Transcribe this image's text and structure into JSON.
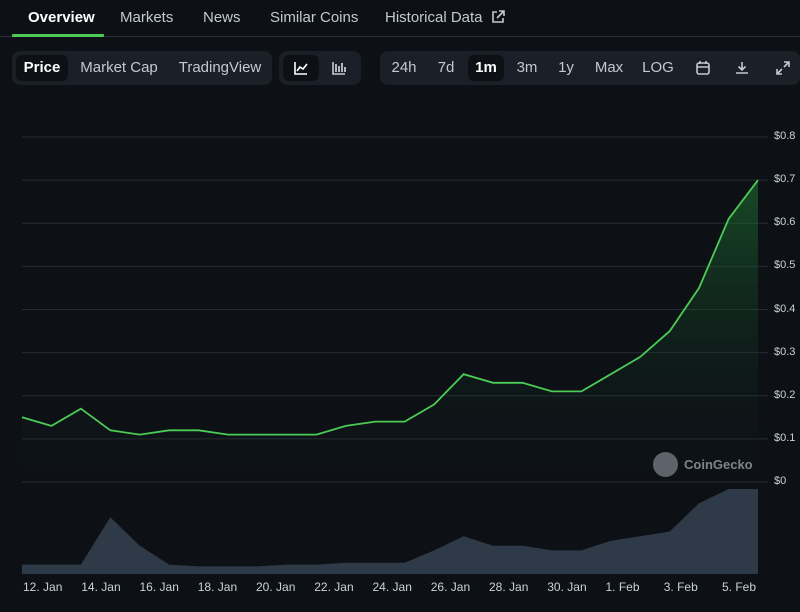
{
  "tabs": [
    {
      "label": "Overview",
      "active": true
    },
    {
      "label": "Markets"
    },
    {
      "label": "News"
    },
    {
      "label": "Similar Coins"
    },
    {
      "label": "Historical Data",
      "external_icon": "external-link-icon"
    }
  ],
  "view_toggle": {
    "items": [
      "Price",
      "Market Cap",
      "TradingView"
    ],
    "selected": "Price"
  },
  "chart_type_toggle": {
    "items": [
      "line-chart-icon",
      "candlestick-chart-icon"
    ],
    "selected": "line-chart-icon"
  },
  "range_toggle": {
    "items": [
      "24h",
      "7d",
      "1m",
      "3m",
      "1y",
      "Max",
      "LOG"
    ],
    "selected": "1m",
    "tools": [
      "calendar-icon",
      "download-icon",
      "fullscreen-icon"
    ]
  },
  "colors": {
    "line": "#4bcb55",
    "accent": "#4bcb55",
    "volume": "#2f3a48",
    "background": "#0d1116"
  },
  "watermark": "CoinGecko",
  "chart_data": {
    "type": "area",
    "x": [
      "12 Jan",
      "13 Jan",
      "14 Jan",
      "15 Jan",
      "16 Jan",
      "17 Jan",
      "18 Jan",
      "19 Jan",
      "20 Jan",
      "21 Jan",
      "22 Jan",
      "23 Jan",
      "24 Jan",
      "25 Jan",
      "26 Jan",
      "27 Jan",
      "28 Jan",
      "29 Jan",
      "30 Jan",
      "31 Jan",
      "1 Feb",
      "2 Feb",
      "3 Feb",
      "4 Feb",
      "5 Feb",
      "5.5 Feb"
    ],
    "price_values": [
      0.15,
      0.13,
      0.17,
      0.12,
      0.11,
      0.12,
      0.12,
      0.11,
      0.11,
      0.11,
      0.11,
      0.13,
      0.14,
      0.14,
      0.18,
      0.25,
      0.23,
      0.23,
      0.21,
      0.21,
      0.25,
      0.29,
      0.35,
      0.45,
      0.61,
      0.7
    ],
    "volume_values": [
      0.1,
      0.1,
      0.1,
      0.6,
      0.3,
      0.1,
      0.08,
      0.08,
      0.08,
      0.1,
      0.1,
      0.12,
      0.12,
      0.12,
      0.25,
      0.4,
      0.3,
      0.3,
      0.25,
      0.25,
      0.35,
      0.4,
      0.45,
      0.75,
      0.9,
      0.9
    ],
    "xticks": [
      "12. Jan",
      "14. Jan",
      "16. Jan",
      "18. Jan",
      "20. Jan",
      "22. Jan",
      "24. Jan",
      "26. Jan",
      "28. Jan",
      "30. Jan",
      "1. Feb",
      "3. Feb",
      "5. Feb"
    ],
    "yticks": [
      "$0",
      "$0.1",
      "$0.2",
      "$0.3",
      "$0.4",
      "$0.5",
      "$0.6",
      "$0.7",
      "$0.8"
    ],
    "ylim": [
      0,
      0.8
    ],
    "grid": true
  }
}
